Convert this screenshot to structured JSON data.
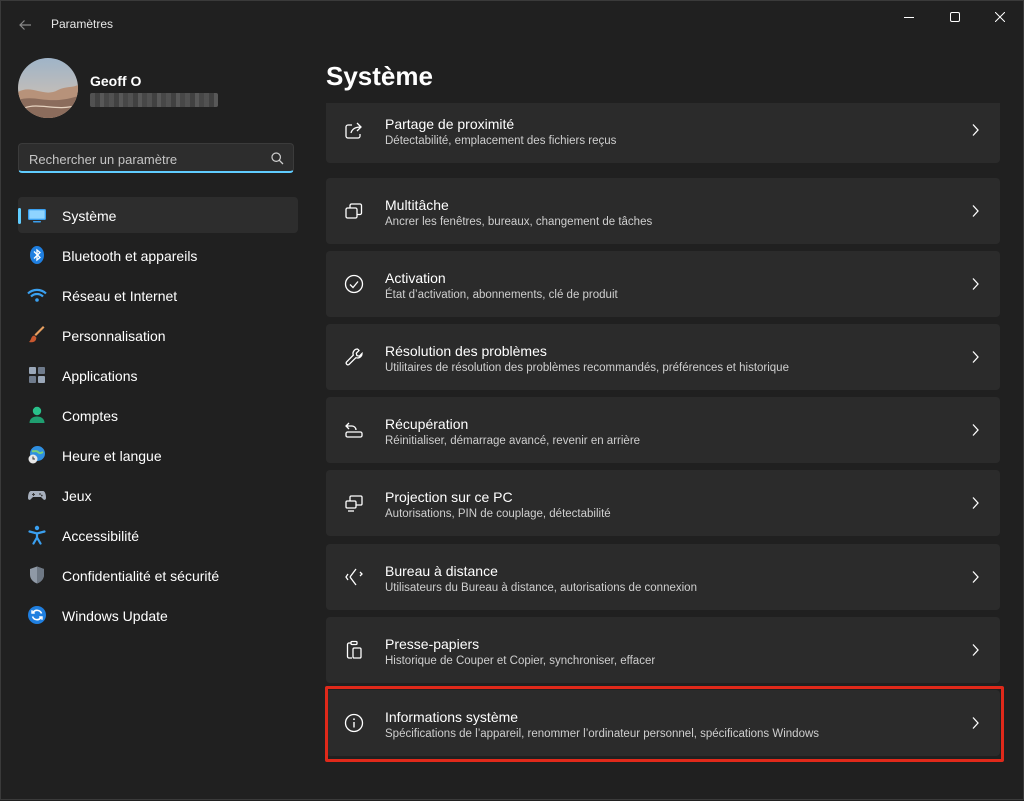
{
  "window": {
    "title": "Paramètres"
  },
  "profile": {
    "name": "Geoff O"
  },
  "search": {
    "placeholder": "Rechercher un paramètre"
  },
  "nav": {
    "items": [
      {
        "label": "Système",
        "icon": "system-icon",
        "selected": true
      },
      {
        "label": "Bluetooth et appareils",
        "icon": "bluetooth-icon"
      },
      {
        "label": "Réseau et Internet",
        "icon": "wifi-icon"
      },
      {
        "label": "Personnalisation",
        "icon": "brush-icon"
      },
      {
        "label": "Applications",
        "icon": "apps-icon"
      },
      {
        "label": "Comptes",
        "icon": "account-icon"
      },
      {
        "label": "Heure et langue",
        "icon": "globe-clock-icon"
      },
      {
        "label": "Jeux",
        "icon": "gamepad-icon"
      },
      {
        "label": "Accessibilité",
        "icon": "accessibility-icon"
      },
      {
        "label": "Confidentialité et sécurité",
        "icon": "shield-icon"
      },
      {
        "label": "Windows Update",
        "icon": "update-icon"
      }
    ]
  },
  "main": {
    "title": "Système",
    "cards": [
      {
        "title": "Partage de proximité",
        "subtitle": "Détectabilité, emplacement des fichiers reçus",
        "icon": "share-icon"
      },
      {
        "title": "Multitâche",
        "subtitle": "Ancrer les fenêtres, bureaux, changement de tâches",
        "icon": "multitask-icon"
      },
      {
        "title": "Activation",
        "subtitle": "État d’activation, abonnements, clé de produit",
        "icon": "check-circle-icon"
      },
      {
        "title": "Résolution des problèmes",
        "subtitle": "Utilitaires de résolution des problèmes recommandés, préférences et historique",
        "icon": "wrench-icon"
      },
      {
        "title": "Récupération",
        "subtitle": "Réinitialiser, démarrage avancé, revenir en arrière",
        "icon": "recovery-icon"
      },
      {
        "title": "Projection sur ce PC",
        "subtitle": "Autorisations, PIN de couplage, détectabilité",
        "icon": "projection-icon"
      },
      {
        "title": "Bureau à distance",
        "subtitle": "Utilisateurs du Bureau à distance, autorisations de connexion",
        "icon": "remote-desktop-icon"
      },
      {
        "title": "Presse-papiers",
        "subtitle": "Historique de Couper et Copier, synchroniser, effacer",
        "icon": "clipboard-icon"
      },
      {
        "title": "Informations système",
        "subtitle": "Spécifications de l’appareil, renommer l’ordinateur personnel, spécifications Windows",
        "icon": "info-icon",
        "highlighted": true
      }
    ]
  },
  "colors": {
    "accent": "#60cdff",
    "highlight": "#e0291a",
    "card": "#2b2b2b",
    "background": "#202020"
  }
}
